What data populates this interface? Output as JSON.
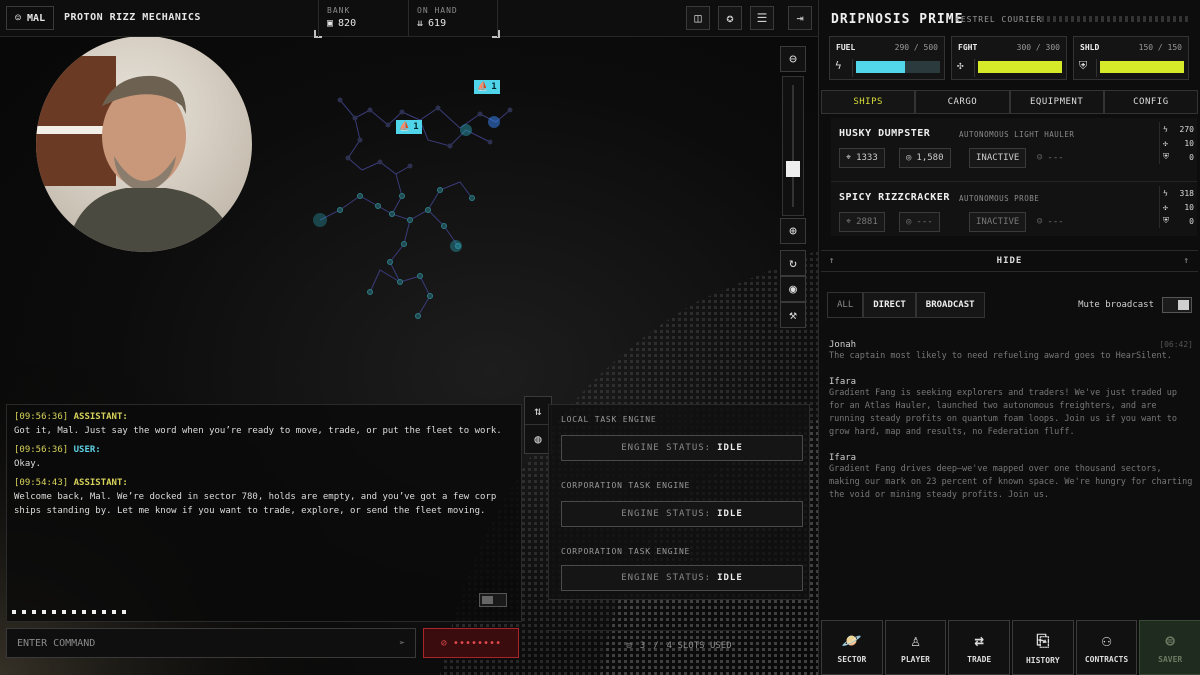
{
  "topbar": {
    "user": "MAL",
    "corp_name": "PROTON RIZZ MECHANICS",
    "bank_label": "BANK",
    "bank_value": "820",
    "onhand_label": "ON HAND",
    "onhand_value": "619"
  },
  "map": {
    "markers": [
      {
        "icon": "ship-icon",
        "count": "1"
      },
      {
        "icon": "ship-icon",
        "count": "1"
      }
    ]
  },
  "chat": {
    "messages": [
      {
        "time": "[09:56:36]",
        "role": "ASSISTANT:",
        "text": "Got it, Mal. Just say the word when you’re ready to move, trade, or put the fleet to work."
      },
      {
        "time": "[09:56:36]",
        "role": "USER:",
        "text": "Okay."
      },
      {
        "time": "[09:54:43]",
        "role": "ASSISTANT:",
        "text": "Welcome back, Mal. We’re docked in sector 780, holds are empty, and you’ve got a few corp ships standing by. Let me know if you want to trade, explore, or send the fleet moving."
      }
    ],
    "input_placeholder": "ENTER COMMAND",
    "mic_label": "••••••••"
  },
  "engines": [
    {
      "title": "LOCAL TASK ENGINE",
      "status_label": "ENGINE STATUS:",
      "status": "IDLE"
    },
    {
      "title": "CORPORATION TASK ENGINE",
      "status_label": "ENGINE STATUS:",
      "status": "IDLE"
    },
    {
      "title": "CORPORATION TASK ENGINE",
      "status_label": "ENGINE STATUS:",
      "status": "IDLE"
    }
  ],
  "slots": {
    "used": "3",
    "total": "4 SLOTS USED",
    "sep": "/"
  },
  "ship": {
    "name": "DRIPNOSIS PRIME",
    "type": "KESTREL COURIER",
    "fuel": {
      "label": "FUEL",
      "value": "290 / 500",
      "fraction": 0.58,
      "color": "#52d6ea"
    },
    "fight": {
      "label": "FGHT",
      "value": "300 / 300",
      "fraction": 1.0,
      "color": "#d6ea2a"
    },
    "shld": {
      "label": "SHLD",
      "value": "150 / 150",
      "fraction": 1.0,
      "color": "#d6ea2a"
    }
  },
  "tabs": [
    "SHIPS",
    "CARGO",
    "EQUIPMENT",
    "CONFIG"
  ],
  "ships": [
    {
      "name": "HUSKY DUMPSTER",
      "type": "AUTONOMOUS LIGHT HAULER",
      "sector": "1333",
      "credits": "1,580",
      "status": "INACTIVE",
      "pilot": "---",
      "fuel": "270",
      "fight": "10",
      "shld": "0"
    },
    {
      "name": "SPICY RIZZCRACKER",
      "type": "AUTONOMOUS PROBE",
      "sector": "2881",
      "credits": "---",
      "status": "INACTIVE",
      "pilot": "---",
      "fuel": "318",
      "fight": "10",
      "shld": "0"
    }
  ],
  "hide_label": "HIDE",
  "msg_tabs": [
    "ALL",
    "DIRECT",
    "BROADCAST"
  ],
  "mute_label": "Mute broadcast",
  "broadcasts": [
    {
      "author": "Jonah",
      "time": "[06:42]",
      "text": "The captain most likely to need refueling award goes to HearSilent."
    },
    {
      "author": "Ifara",
      "time": "",
      "text": "Gradient Fang is seeking explorers and traders! We've just traded up for an Atlas Hauler, launched two autonomous freighters, and are running steady profits on quantum foam loops. Join us if you want to grow hard, map and results, no Federation fluff."
    },
    {
      "author": "Ifara",
      "time": "",
      "text": "Gradient Fang drives deep—we've mapped over one thousand sectors, making our mark on 23 percent of known space. We're hungry for charting the void or mining steady profits. Join us."
    }
  ],
  "nav": [
    {
      "icon": "planet-icon",
      "label": "SECTOR"
    },
    {
      "icon": "player-icon",
      "label": "PLAYER"
    },
    {
      "icon": "trade-icon",
      "label": "TRADE"
    },
    {
      "icon": "history-icon",
      "label": "HISTORY"
    },
    {
      "icon": "contracts-icon",
      "label": "CONTRACTS"
    },
    {
      "icon": "saver-icon",
      "label": "SAVER"
    }
  ]
}
